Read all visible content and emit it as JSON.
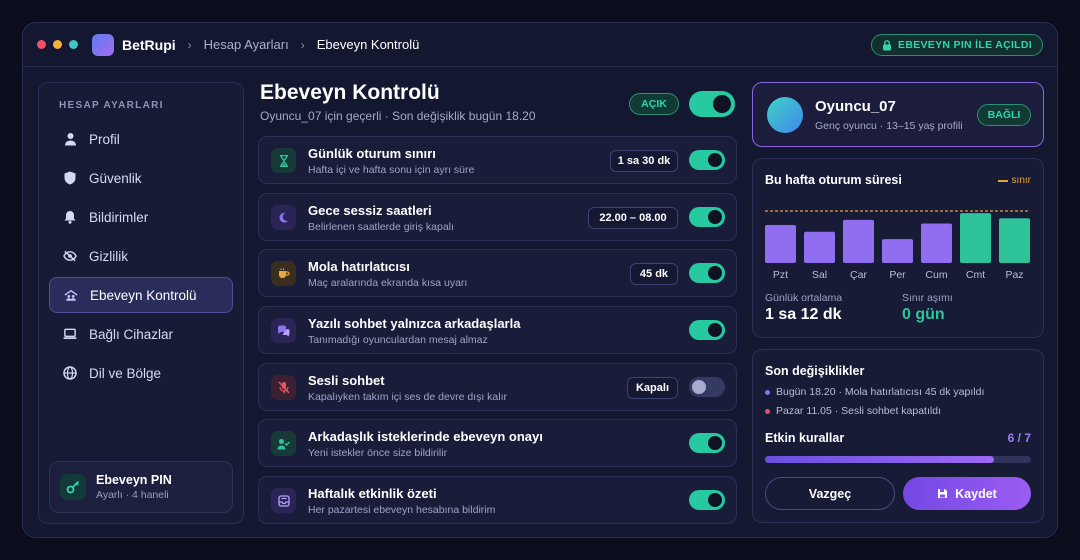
{
  "titlebar": {
    "brand": "BetRupi",
    "breadcrumb": [
      "Hesap Ayarları",
      "Ebeveyn Kontrolü"
    ],
    "pin_badge": "EBEVEYN PIN İLE AÇILDI"
  },
  "sidebar": {
    "title": "HESAP AYARLARI",
    "items": [
      {
        "label": "Profil",
        "icon": "user-icon"
      },
      {
        "label": "Güvenlik",
        "icon": "shield-icon"
      },
      {
        "label": "Bildirimler",
        "icon": "bell-icon"
      },
      {
        "label": "Gizlilik",
        "icon": "eye-off-icon"
      },
      {
        "label": "Ebeveyn Kontrolü",
        "icon": "family-icon",
        "active": true
      },
      {
        "label": "Bağlı Cihazlar",
        "icon": "laptop-icon"
      },
      {
        "label": "Dil ve Bölge",
        "icon": "globe-icon"
      }
    ],
    "pin": {
      "title": "Ebeveyn PIN",
      "subtitle": "Ayarlı · 4 haneli"
    }
  },
  "main": {
    "title": "Ebeveyn Kontrolü",
    "subtitle": "Oyuncu_07 için geçerli · Son değişiklik bugün 18.20",
    "status": "AÇIK",
    "master_on": true,
    "rules": [
      {
        "title": "Günlük oturum sınırı",
        "subtitle": "Hafta içi ve hafta sonu için ayrı süre",
        "value": "1 sa 30 dk",
        "on": true,
        "icon": "hourglass-icon",
        "color": "#2fc39a"
      },
      {
        "title": "Gece sessiz saatleri",
        "subtitle": "Belirlenen saatlerde giriş kapalı",
        "value": "22.00 – 08.00",
        "on": true,
        "icon": "moon-icon",
        "color": "#8e74f0"
      },
      {
        "title": "Mola hatırlatıcısı",
        "subtitle": "Maç aralarında ekranda kısa uyarı",
        "value": "45 dk",
        "on": true,
        "icon": "coffee-icon",
        "color": "#e8a73a"
      },
      {
        "title": "Yazılı sohbet yalnızca arkadaşlarla",
        "subtitle": "Tanımadığı oyunculardan mesaj almaz",
        "value": "",
        "on": true,
        "icon": "chat-icon",
        "color": "#8e74f0"
      },
      {
        "title": "Sesli sohbet",
        "subtitle": "Kapalıyken takım içi ses de devre dışı kalır",
        "value": "Kapalı",
        "on": false,
        "icon": "mic-off-icon",
        "color": "#e0565f"
      },
      {
        "title": "Arkadaşlık isteklerinde ebeveyn onayı",
        "subtitle": "Yeni istekler önce size bildirilir",
        "value": "",
        "on": true,
        "icon": "user-check-icon",
        "color": "#2fc39a"
      },
      {
        "title": "Haftalık etkinlik özeti",
        "subtitle": "Her pazartesi ebeveyn hesabına bildirim",
        "value": "",
        "on": true,
        "icon": "inbox-icon",
        "color": "#8e74f0"
      }
    ]
  },
  "profile": {
    "name": "Oyuncu_07",
    "subtitle": "Genç oyuncu · 13–15 yaş profili",
    "badge": "BAĞLI"
  },
  "usage": {
    "title": "Bu hafta oturum süresi",
    "limit_label": "sınır",
    "avg_label": "Günlük ortalama",
    "avg_value": "1 sa 12 dk",
    "over_label": "Sınır aşımı",
    "over_value": "0 gün"
  },
  "chart_data": {
    "type": "bar",
    "categories": [
      "Pzt",
      "Sal",
      "Çar",
      "Per",
      "Cum",
      "Cmt",
      "Paz"
    ],
    "values": [
      0.73,
      0.6,
      0.83,
      0.46,
      0.76,
      0.96,
      0.86
    ],
    "limit": 1.0,
    "colors": [
      "#8f6ef0",
      "#8f6ef0",
      "#8f6ef0",
      "#8f6ef0",
      "#8f6ef0",
      "#2fc39a",
      "#2fc39a"
    ],
    "limit_color": "#e3a23a"
  },
  "changes": {
    "title": "Son değişiklikler",
    "items": [
      {
        "text": "Bugün 18.20 · Mola hatırlatıcısı 45 dk yapıldı",
        "color": "#8f6ef0"
      },
      {
        "text": "Pazar 11.05 · Sesli sohbet kapatıldı",
        "color": "#e0565f"
      }
    ],
    "active_label": "Etkin kurallar",
    "active_count": "6 / 7",
    "active_fraction": 0.86,
    "cancel": "Vazgeç",
    "save": "Kaydet"
  }
}
